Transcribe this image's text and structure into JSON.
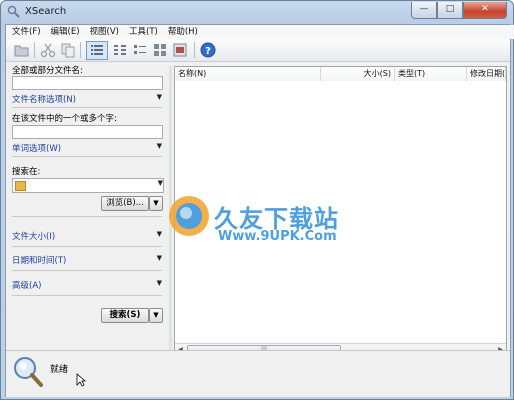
{
  "window": {
    "title": "XSearch",
    "controls": [
      "—",
      "□",
      "✕"
    ]
  },
  "menu": [
    "文件(F)",
    "编辑(E)",
    "视图(V)",
    "工具(T)",
    "帮助(H)"
  ],
  "toolbar": {
    "icons": [
      "open-folder-icon",
      "cut-icon",
      "copy-icon",
      "details-view-icon",
      "list-view-icon",
      "small-icons-view-icon",
      "large-icons-view-icon",
      "thumbnails-view-icon",
      "help-icon"
    ]
  },
  "search_panel": {
    "filename_label": "全部或部分文件名:",
    "filename_value": "",
    "filename_options": "文件名称选项(N)",
    "content_label": "在该文件中的一个或多个字:",
    "content_value": "",
    "word_options": "单词选项(W)",
    "search_in_label": "搜索在:",
    "search_in_value": "",
    "browse_label": "浏览(B)...",
    "file_size": "文件大小(I)",
    "date_time": "日期和时间(T)",
    "advanced": "高级(A)",
    "search_button": "搜索(S)"
  },
  "results": {
    "columns": [
      "名称(N)",
      "大小(S)",
      "类型(T)",
      "修改日期("
    ],
    "scroll_thumb": "|||"
  },
  "status": {
    "text": "就绪"
  },
  "watermark": {
    "title": "久友下载站",
    "url": "Www.9UPK.Com"
  },
  "colors": {
    "link": "#1d3fa8",
    "accent": "#2f8fd8",
    "close": "#c7432c"
  }
}
